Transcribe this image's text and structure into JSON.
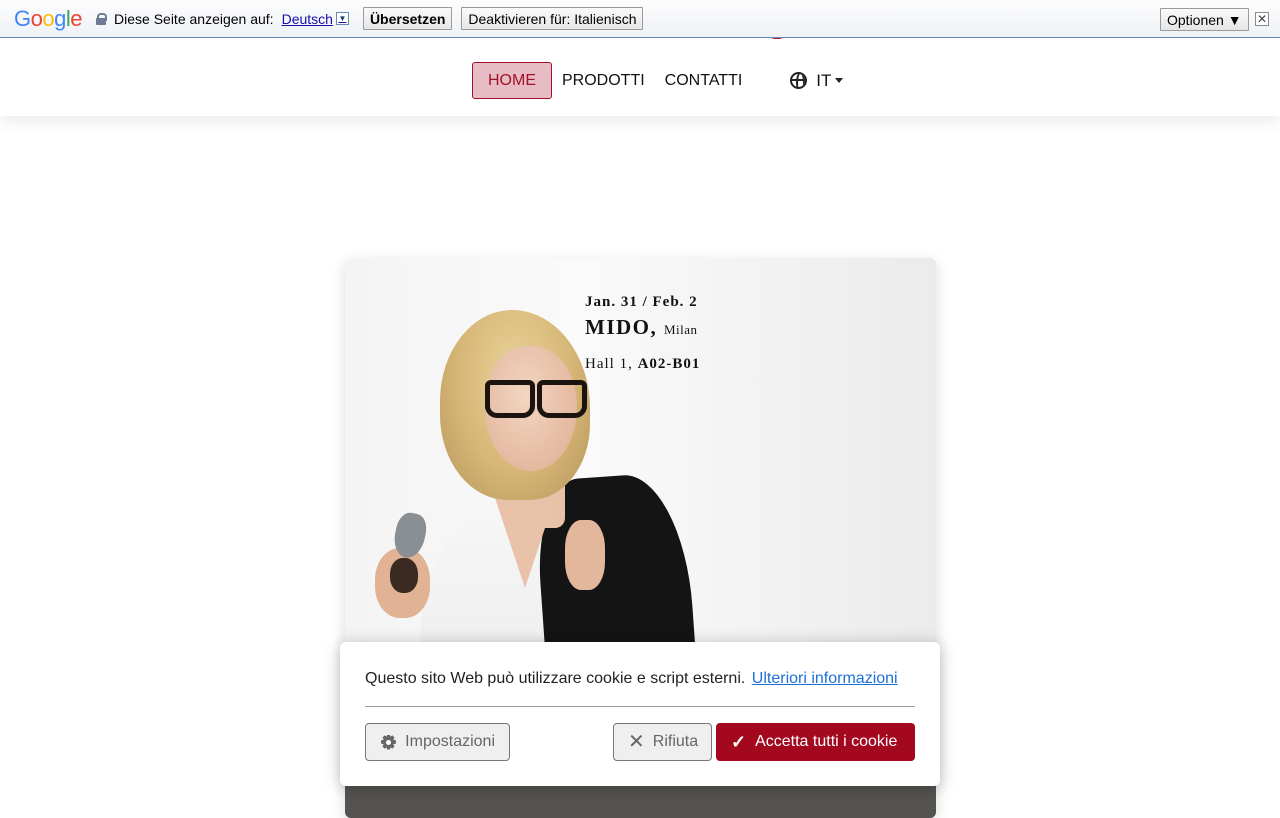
{
  "translate_bar": {
    "logo": [
      "G",
      "o",
      "o",
      "g",
      "l",
      "e"
    ],
    "prompt": "Diese Seite anzeigen auf:",
    "language": "Deutsch",
    "language_arrow": "▼",
    "translate_button": "Übersetzen",
    "disable_button": "Deaktivieren für: Italienisch",
    "options_button": "Optionen ▼",
    "close": "✕"
  },
  "nav": {
    "items": [
      {
        "label": "HOME",
        "active": true
      },
      {
        "label": "PRODOTTI"
      },
      {
        "label": "CONTATTI"
      }
    ],
    "language": "IT"
  },
  "hero": {
    "date": "Jan. 31 / Feb. 2",
    "event": "MIDO,",
    "city": "Milan",
    "hall_prefix": "Hall 1,",
    "booth": "A02-B01"
  },
  "cookie": {
    "message": "Questo sito Web può utilizzare cookie e script esterni.",
    "more_info": "Ulteriori informazioni",
    "settings_button": "Impostazioni",
    "reject_button": "Rifiuta",
    "accept_button": "Accetta tutti i cookie",
    "accent_color": "#a3081f"
  }
}
